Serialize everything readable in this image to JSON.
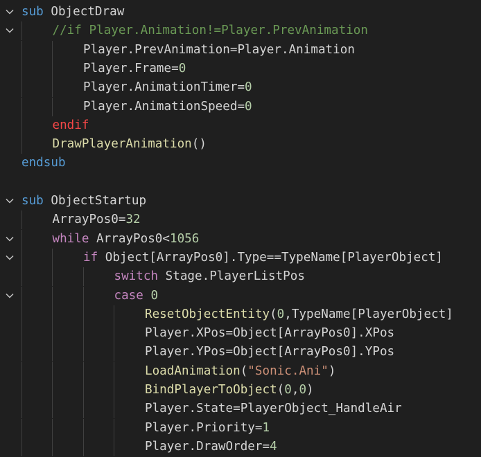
{
  "editor": {
    "language": "RSDK script",
    "colors": {
      "background": "#1f1f1f",
      "keyword": "#569cd6",
      "control": "#c586c0",
      "endif": "#f44747",
      "function": "#dcdcaa",
      "number": "#b5cea8",
      "string": "#ce9178",
      "comment": "#6a9955",
      "text": "#d4d4d4",
      "indent_guide": "#404040",
      "fold_icon": "#c5c5c5"
    },
    "lines": [
      {
        "fold": true,
        "indent": 0,
        "tokens": [
          {
            "t": "kw",
            "v": "sub"
          },
          {
            "t": "id",
            "v": " ObjectDraw"
          }
        ]
      },
      {
        "fold": true,
        "indent": 1,
        "tokens": [
          {
            "t": "com",
            "v": "//if Player.Animation!=Player.PrevAnimation"
          }
        ]
      },
      {
        "fold": false,
        "indent": 2,
        "tokens": [
          {
            "t": "id",
            "v": "Player.PrevAnimation=Player.Animation"
          }
        ]
      },
      {
        "fold": false,
        "indent": 2,
        "tokens": [
          {
            "t": "id",
            "v": "Player.Frame="
          },
          {
            "t": "num",
            "v": "0"
          }
        ]
      },
      {
        "fold": false,
        "indent": 2,
        "tokens": [
          {
            "t": "id",
            "v": "Player.AnimationTimer="
          },
          {
            "t": "num",
            "v": "0"
          }
        ]
      },
      {
        "fold": false,
        "indent": 2,
        "tokens": [
          {
            "t": "id",
            "v": "Player.AnimationSpeed="
          },
          {
            "t": "num",
            "v": "0"
          }
        ]
      },
      {
        "fold": false,
        "indent": 1,
        "tokens": [
          {
            "t": "end",
            "v": "endif"
          }
        ]
      },
      {
        "fold": false,
        "indent": 1,
        "tokens": [
          {
            "t": "fn",
            "v": "DrawPlayerAnimation"
          },
          {
            "t": "id",
            "v": "()"
          }
        ]
      },
      {
        "fold": false,
        "indent": 0,
        "tokens": [
          {
            "t": "kw",
            "v": "endsub"
          }
        ]
      },
      {
        "fold": false,
        "indent": 0,
        "tokens": []
      },
      {
        "fold": true,
        "indent": 0,
        "tokens": [
          {
            "t": "kw",
            "v": "sub"
          },
          {
            "t": "id",
            "v": " ObjectStartup"
          }
        ]
      },
      {
        "fold": false,
        "indent": 1,
        "tokens": [
          {
            "t": "id",
            "v": "ArrayPos0="
          },
          {
            "t": "num",
            "v": "32"
          }
        ]
      },
      {
        "fold": true,
        "indent": 1,
        "tokens": [
          {
            "t": "ctl",
            "v": "while"
          },
          {
            "t": "id",
            "v": " ArrayPos0<"
          },
          {
            "t": "num",
            "v": "1056"
          }
        ]
      },
      {
        "fold": true,
        "indent": 2,
        "tokens": [
          {
            "t": "ctl",
            "v": "if"
          },
          {
            "t": "id",
            "v": " Object[ArrayPos0].Type==TypeName[PlayerObject]"
          }
        ]
      },
      {
        "fold": false,
        "indent": 3,
        "tokens": [
          {
            "t": "ctl",
            "v": "switch"
          },
          {
            "t": "id",
            "v": " Stage.PlayerListPos"
          }
        ]
      },
      {
        "fold": true,
        "indent": 3,
        "tokens": [
          {
            "t": "ctl",
            "v": "case"
          },
          {
            "t": "id",
            "v": " "
          },
          {
            "t": "num",
            "v": "0"
          }
        ]
      },
      {
        "fold": false,
        "indent": 4,
        "tokens": [
          {
            "t": "fn",
            "v": "ResetObjectEntity"
          },
          {
            "t": "id",
            "v": "("
          },
          {
            "t": "num",
            "v": "0"
          },
          {
            "t": "id",
            "v": ",TypeName[PlayerObject]"
          }
        ]
      },
      {
        "fold": false,
        "indent": 4,
        "tokens": [
          {
            "t": "id",
            "v": "Player.XPos=Object[ArrayPos0].XPos"
          }
        ]
      },
      {
        "fold": false,
        "indent": 4,
        "tokens": [
          {
            "t": "id",
            "v": "Player.YPos=Object[ArrayPos0].YPos"
          }
        ]
      },
      {
        "fold": false,
        "indent": 4,
        "tokens": [
          {
            "t": "fn",
            "v": "LoadAnimation"
          },
          {
            "t": "id",
            "v": "("
          },
          {
            "t": "str",
            "v": "\"Sonic.Ani\""
          },
          {
            "t": "id",
            "v": ")"
          }
        ]
      },
      {
        "fold": false,
        "indent": 4,
        "tokens": [
          {
            "t": "fn",
            "v": "BindPlayerToObject"
          },
          {
            "t": "id",
            "v": "("
          },
          {
            "t": "num",
            "v": "0"
          },
          {
            "t": "id",
            "v": ","
          },
          {
            "t": "num",
            "v": "0"
          },
          {
            "t": "id",
            "v": ")"
          }
        ]
      },
      {
        "fold": false,
        "indent": 4,
        "tokens": [
          {
            "t": "id",
            "v": "Player.State=PlayerObject_HandleAir"
          }
        ]
      },
      {
        "fold": false,
        "indent": 4,
        "tokens": [
          {
            "t": "id",
            "v": "Player.Priority="
          },
          {
            "t": "num",
            "v": "1"
          }
        ]
      },
      {
        "fold": false,
        "indent": 4,
        "tokens": [
          {
            "t": "id",
            "v": "Player.DrawOrder="
          },
          {
            "t": "num",
            "v": "4"
          }
        ]
      }
    ]
  }
}
